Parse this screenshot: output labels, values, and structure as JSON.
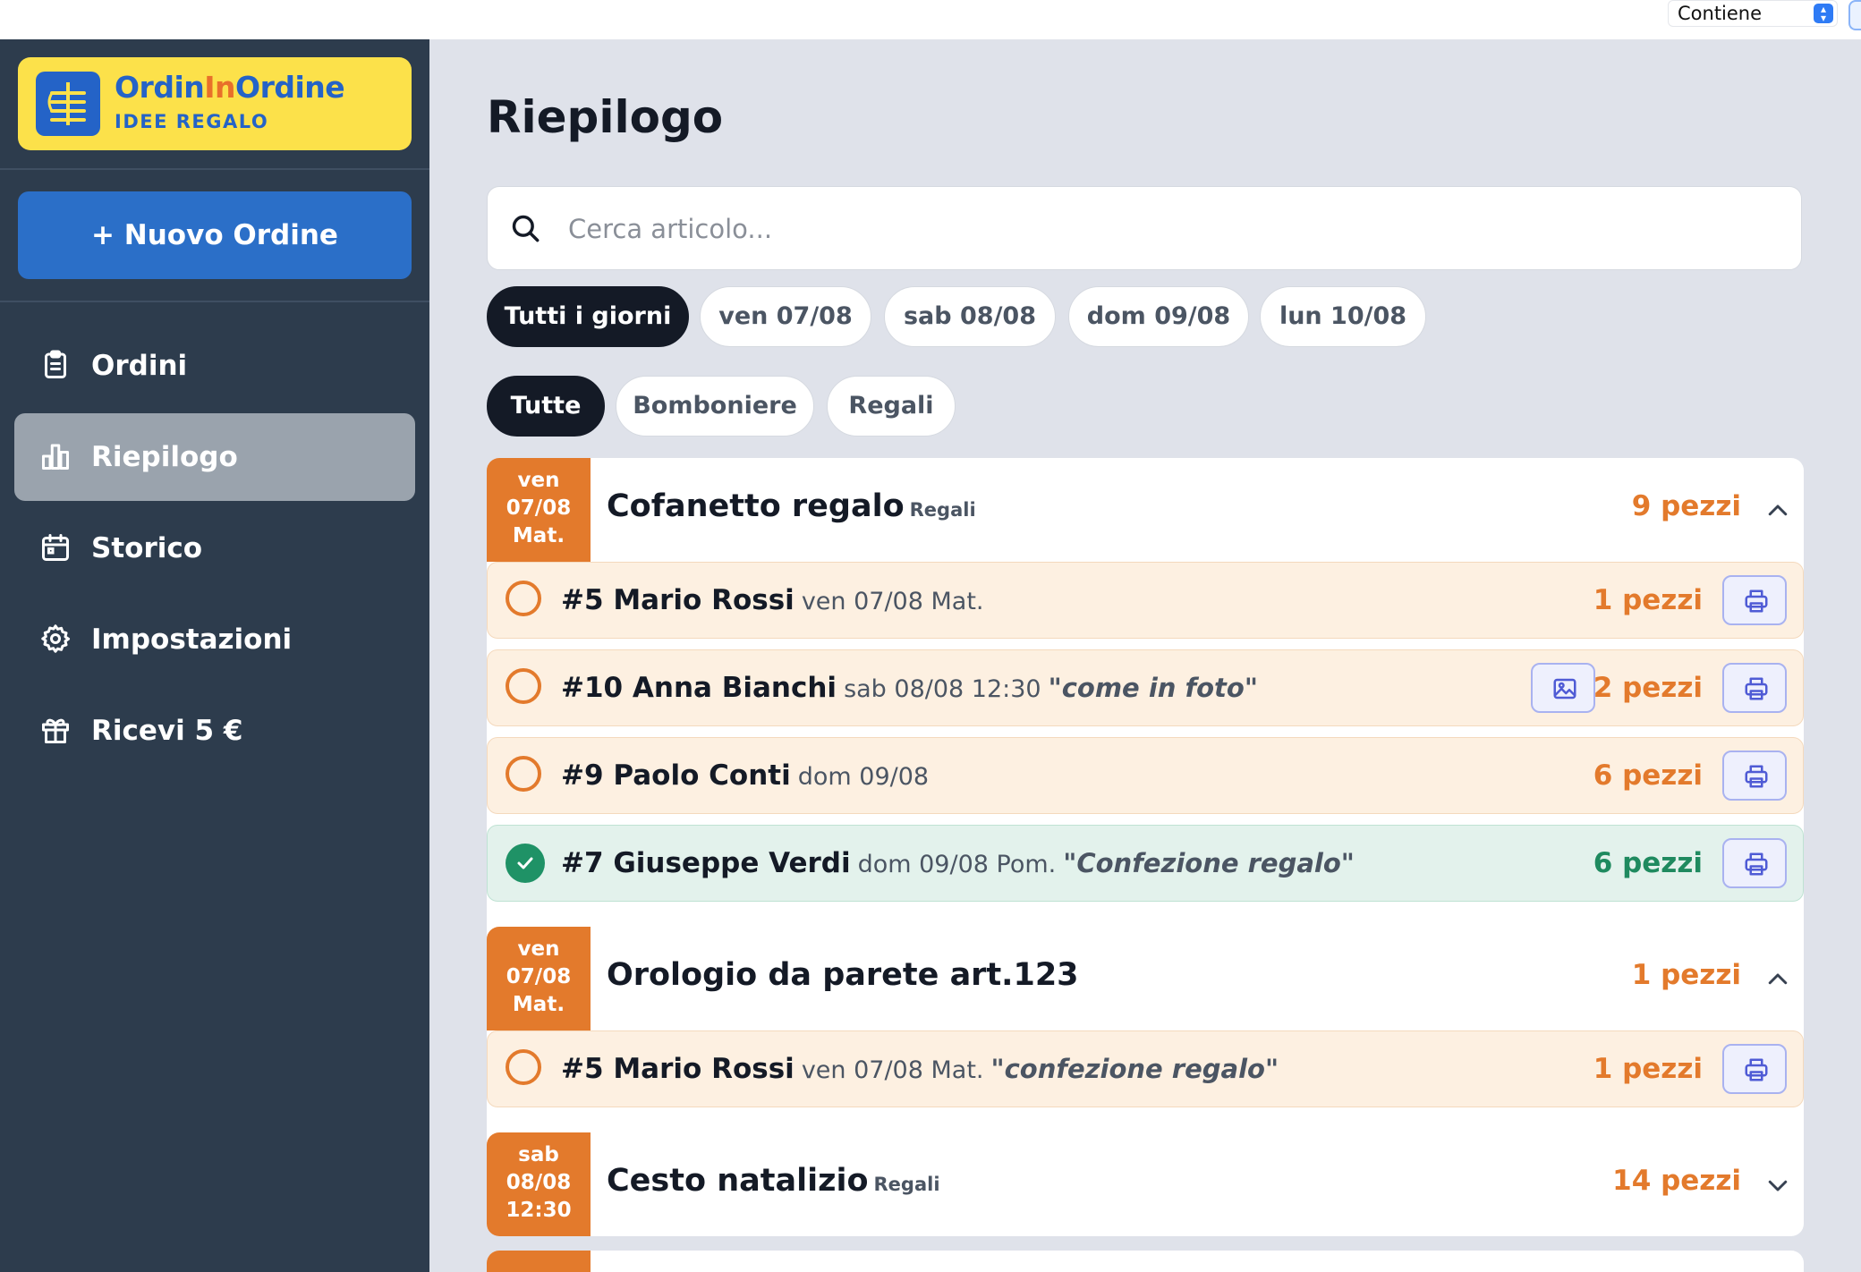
{
  "toolbar": {
    "filter_mode": "Contiene"
  },
  "brand": {
    "name_part1": "Ordin",
    "name_part2": "In",
    "name_part3": "Ordine",
    "subtitle": "IDEE REGALO"
  },
  "sidebar": {
    "new_order_label": "+ Nuovo Ordine",
    "items": [
      {
        "label": "Ordini",
        "icon": "clipboard-icon"
      },
      {
        "label": "Riepilogo",
        "icon": "bar-chart-icon",
        "active": true
      },
      {
        "label": "Storico",
        "icon": "calendar-icon"
      },
      {
        "label": "Impostazioni",
        "icon": "gear-icon"
      },
      {
        "label": "Ricevi 5 €",
        "icon": "gift-icon"
      }
    ]
  },
  "main": {
    "title": "Riepilogo",
    "search": {
      "placeholder": "Cerca articolo...",
      "value": ""
    },
    "day_filters": [
      {
        "label": "Tutti i giorni",
        "selected": true
      },
      {
        "label": "ven 07/08",
        "selected": false
      },
      {
        "label": "sab 08/08",
        "selected": false
      },
      {
        "label": "dom 09/08",
        "selected": false
      },
      {
        "label": "lun 10/08",
        "selected": false
      }
    ],
    "category_filters": [
      {
        "label": "Tutte",
        "selected": true
      },
      {
        "label": "Bomboniere",
        "selected": false
      },
      {
        "label": "Regali",
        "selected": false
      }
    ],
    "products": [
      {
        "date_line1": "ven",
        "date_line2": "07/08",
        "date_line3": "Mat.",
        "name": "Cofanetto regalo",
        "category": "Regali",
        "qty": "9 pezzi",
        "expanded": true,
        "orders": [
          {
            "name": "#5 Mario Rossi",
            "when": "ven 07/08 Mat.",
            "note": "",
            "qty": "1 pezzi",
            "done": false,
            "has_photo": false
          },
          {
            "name": "#10 Anna Bianchi",
            "when": "sab 08/08 12:30",
            "note": "\"come in foto\"",
            "qty": "2 pezzi",
            "done": false,
            "has_photo": true
          },
          {
            "name": "#9 Paolo Conti",
            "when": "dom 09/08",
            "note": "",
            "qty": "6 pezzi",
            "done": false,
            "has_photo": false
          },
          {
            "name": "#7 Giuseppe Verdi",
            "when": "dom 09/08 Pom.",
            "note": "\"Confezione regalo\"",
            "qty": "6 pezzi",
            "done": true,
            "has_photo": false
          }
        ]
      },
      {
        "date_line1": "ven",
        "date_line2": "07/08",
        "date_line3": "Mat.",
        "name": "Orologio da parete art.123",
        "category": "",
        "qty": "1 pezzi",
        "expanded": true,
        "orders": [
          {
            "name": "#5 Mario Rossi",
            "when": "ven 07/08 Mat.",
            "note": "\"confezione regalo\"",
            "qty": "1 pezzi",
            "done": false,
            "has_photo": false
          }
        ]
      },
      {
        "date_line1": "sab",
        "date_line2": "08/08",
        "date_line3": "12:30",
        "name": "Cesto natalizio",
        "category": "Regali",
        "qty": "14 pezzi",
        "expanded": false,
        "orders": []
      }
    ]
  },
  "colors": {
    "sidebar_bg": "#2d3c4d",
    "accent_orange": "#e37a2c",
    "accent_green": "#1f9266",
    "brand_blue": "#2463c7",
    "brand_yellow": "#fce14a",
    "main_bg": "#dfe2ea"
  }
}
